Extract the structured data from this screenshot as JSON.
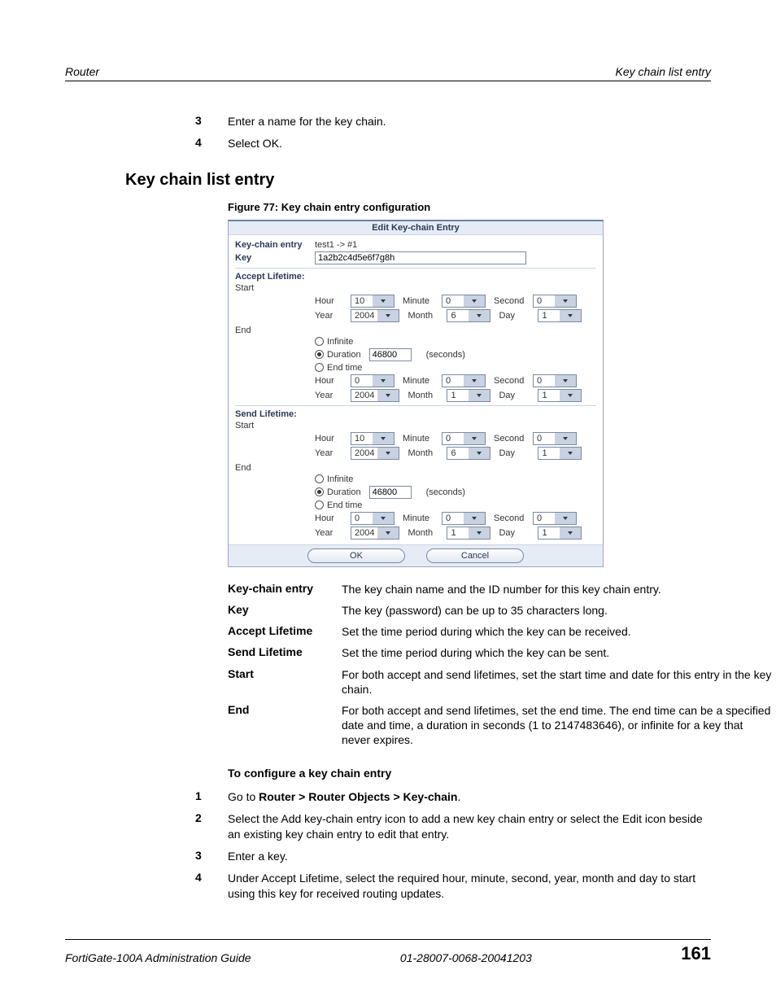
{
  "header": {
    "left": "Router",
    "right": "Key chain list entry"
  },
  "intro_steps": [
    {
      "n": "3",
      "t": "Enter a name for the key chain."
    },
    {
      "n": "4",
      "t": "Select OK."
    }
  ],
  "section_title": "Key chain list entry",
  "figure_caption": "Figure 77: Key chain entry configuration",
  "panel": {
    "title": "Edit Key-chain Entry",
    "entry_label": "Key-chain entry",
    "entry_value": "test1 -> #1",
    "key_label": "Key",
    "key_value": "1a2b2c4d5e6f7g8h",
    "accept_label": "Accept Lifetime:",
    "send_label": "Send Lifetime:",
    "start_label": "Start",
    "end_label": "End",
    "labels": {
      "hour": "Hour",
      "minute": "Minute",
      "second": "Second",
      "year": "Year",
      "month": "Month",
      "day": "Day",
      "infinite": "Infinite",
      "duration": "Duration",
      "endtime": "End time",
      "seconds": "(seconds)"
    },
    "accept": {
      "start": {
        "hour": "10",
        "minute": "0",
        "second": "0",
        "year": "2004",
        "month": "6",
        "day": "1"
      },
      "end": {
        "duration": "46800",
        "hour": "0",
        "minute": "0",
        "second": "0",
        "year": "2004",
        "month": "1",
        "day": "1"
      }
    },
    "send": {
      "start": {
        "hour": "10",
        "minute": "0",
        "second": "0",
        "year": "2004",
        "month": "6",
        "day": "1"
      },
      "end": {
        "duration": "46800",
        "hour": "0",
        "minute": "0",
        "second": "0",
        "year": "2004",
        "month": "1",
        "day": "1"
      }
    },
    "ok": "OK",
    "cancel": "Cancel"
  },
  "definitions": [
    {
      "term": "Key-chain entry",
      "desc": "The key chain name and the ID number for this key chain entry."
    },
    {
      "term": "Key",
      "desc": "The key (password) can be up to 35 characters long."
    },
    {
      "term": "Accept Lifetime",
      "desc": "Set the time period during which the key can be received."
    },
    {
      "term": "Send Lifetime",
      "desc": "Set the time period during which the key can be sent."
    },
    {
      "term": "Start",
      "desc": "For both accept and send lifetimes, set the start time and date for this entry in the key chain."
    },
    {
      "term": "End",
      "desc": "For both accept and send lifetimes, set the end time. The end time can be a specified date and time, a duration in seconds (1 to 2147483646), or infinite for a key that never expires."
    }
  ],
  "configure_heading": "To configure a key chain entry",
  "steps2": {
    "s1": {
      "n": "1",
      "prefix": "Go to ",
      "bold": "Router > Router Objects > Key-chain",
      "suffix": "."
    },
    "s2": {
      "n": "2",
      "t": "Select the Add key-chain entry icon to add a new key chain entry or select the Edit icon beside an existing key chain entry to edit that entry."
    },
    "s3": {
      "n": "3",
      "t": "Enter a key."
    },
    "s4": {
      "n": "4",
      "t": "Under Accept Lifetime, select the required hour, minute, second, year, month and day to start using this key for received routing updates."
    }
  },
  "footer": {
    "left": "FortiGate-100A Administration Guide",
    "center": "01-28007-0068-20041203",
    "page": "161"
  }
}
